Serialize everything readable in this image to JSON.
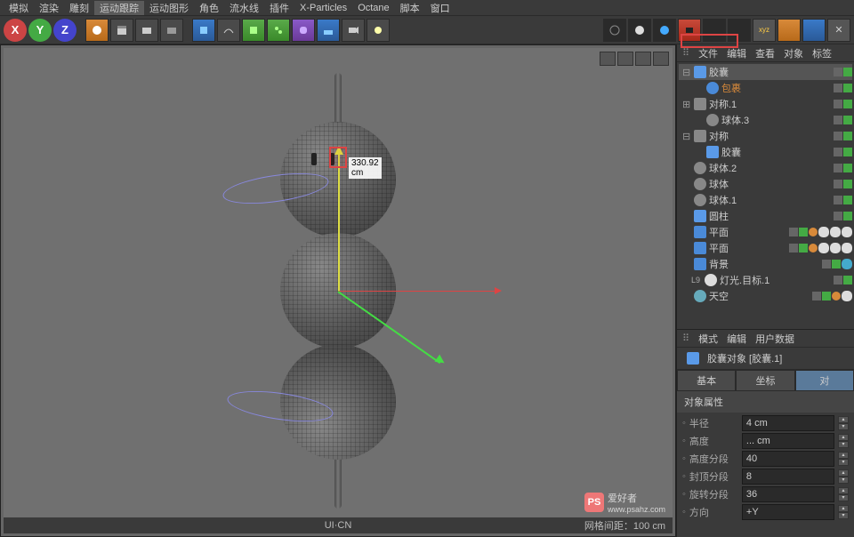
{
  "menu": {
    "items": [
      "模拟",
      "渲染",
      "雕刻",
      "运动跟踪",
      "运动图形",
      "角色",
      "流水线",
      "插件",
      "X-Particles",
      "Octane",
      "脚本",
      "窗口"
    ]
  },
  "toolbar": {
    "axes": [
      "X",
      "Y",
      "Z"
    ]
  },
  "panel_header": {
    "items": [
      "文件",
      "编辑",
      "查看",
      "对象",
      "标签"
    ]
  },
  "tree": {
    "items": [
      {
        "label": "胶囊",
        "icon": "capsule",
        "indent": 0,
        "toggle": "⊟",
        "highlighted": true
      },
      {
        "label": "包裹",
        "icon": "null",
        "indent": 1,
        "orange": true
      },
      {
        "label": "对称.1",
        "icon": "sym",
        "indent": 0,
        "toggle": "⊞"
      },
      {
        "label": "球体.3",
        "icon": "sphere",
        "indent": 1
      },
      {
        "label": "对称",
        "icon": "sym",
        "indent": 0,
        "toggle": "⊟"
      },
      {
        "label": "胶囊",
        "icon": "capsule",
        "indent": 1
      },
      {
        "label": "球体.2",
        "icon": "sphere",
        "indent": 0
      },
      {
        "label": "球体",
        "icon": "sphere",
        "indent": 0
      },
      {
        "label": "球体.1",
        "icon": "sphere",
        "indent": 0
      },
      {
        "label": "圆柱",
        "icon": "capsule",
        "indent": 0
      },
      {
        "label": "平面",
        "icon": "plane",
        "indent": 0,
        "extra_tags": true
      },
      {
        "label": "平面",
        "icon": "plane",
        "indent": 0,
        "extra_tags": true
      },
      {
        "label": "背景",
        "icon": "plane",
        "indent": 0,
        "blue_tag": true
      },
      {
        "label": "灯光.目标.1",
        "icon": "light",
        "indent": 0,
        "prefix": "L9"
      },
      {
        "label": "天空",
        "icon": "sky",
        "indent": 0,
        "ball_tag": true
      }
    ]
  },
  "attr": {
    "header": [
      "模式",
      "编辑",
      "用户数据"
    ],
    "object_name": "胶囊对象 [胶囊.1]",
    "tabs": [
      "基本",
      "坐标",
      "对"
    ],
    "section_title": "对象属性",
    "rows": [
      {
        "label": "半径",
        "value": "4 cm"
      },
      {
        "label": "高度",
        "value": "... cm"
      },
      {
        "label": "高度分段",
        "value": "40"
      },
      {
        "label": "封顶分段",
        "value": "8"
      },
      {
        "label": "旋转分段",
        "value": "36"
      },
      {
        "label": "方向",
        "value": "+Y"
      }
    ]
  },
  "viewport": {
    "dimension": "330.92 cm",
    "status_center": "UI·CN",
    "status_right": "网格间距：100 cm"
  },
  "watermark": {
    "icon": "PS",
    "text": "爱好者",
    "url": "www.psahz.com"
  }
}
